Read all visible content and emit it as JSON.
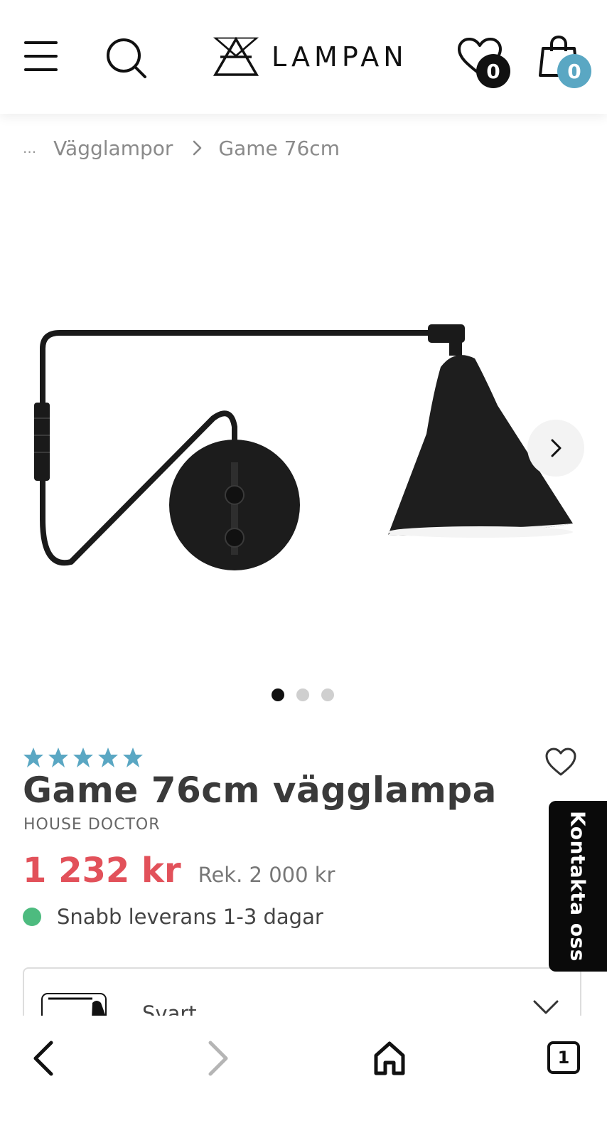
{
  "header": {
    "logo_text": "LAMPAN",
    "wishlist_count": "0",
    "cart_count": "0"
  },
  "breadcrumb": {
    "ellipsis": "...",
    "items": [
      "Vägglampor",
      "Game 76cm"
    ]
  },
  "gallery": {
    "image_count": 3,
    "active_index": 0
  },
  "product": {
    "rating_stars": 5,
    "title": "Game 76cm vägglampa",
    "brand": "HOUSE DOCTOR",
    "price": "1 232 kr",
    "recommended_price": "Rek. 2 000 kr",
    "stock_text": "Snabb leverans 1-3 dagar",
    "variant_label": "Svart"
  },
  "contact": {
    "label": "Kontakta oss"
  },
  "browser": {
    "tab_count": "1"
  },
  "colors": {
    "price_red": "#e2515a",
    "star_blue": "#5aa7c3",
    "cart_badge": "#5aa7c3",
    "stock_green": "#4dbb7f"
  }
}
